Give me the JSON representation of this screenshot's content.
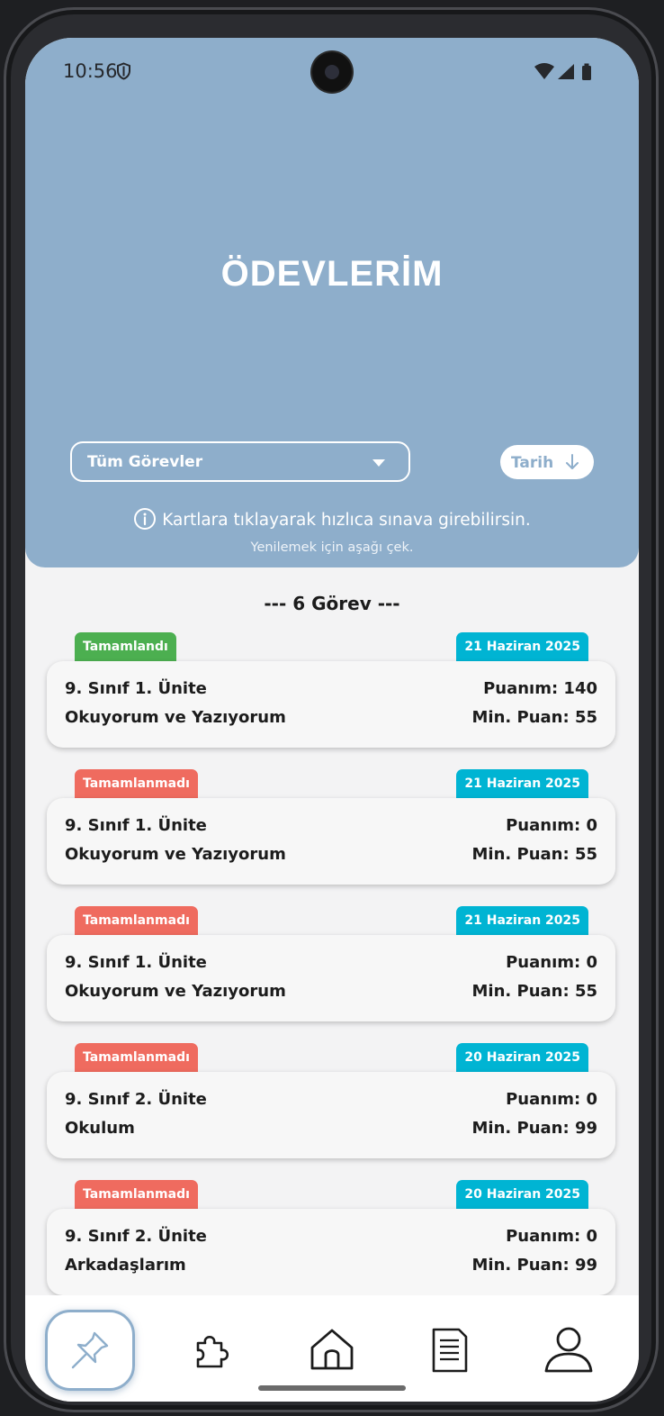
{
  "status_bar": {
    "time": "10:56"
  },
  "header": {
    "title": "ÖDEVLERİM",
    "filter": {
      "selected": "Tüm Görevler"
    },
    "sort": {
      "label": "Tarih"
    },
    "info_text": "Kartlara tıklayarak hızlıca sınava girebilirsin.",
    "refresh_hint": "Yenilemek için aşağı çek."
  },
  "list": {
    "count_text": "--- 6 Görev ---",
    "tasks": [
      {
        "status": "Tamamlandı",
        "status_type": "done",
        "date": "21 Haziran 2025",
        "unit": "9. Sınıf 1. Ünite",
        "topic": "Okuyorum ve Yazıyorum",
        "score": "Puanım: 140",
        "min_score": "Min. Puan: 55"
      },
      {
        "status": "Tamamlanmadı",
        "status_type": "notdone",
        "date": "21 Haziran 2025",
        "unit": "9. Sınıf 1. Ünite",
        "topic": "Okuyorum ve Yazıyorum",
        "score": "Puanım: 0",
        "min_score": "Min. Puan: 55"
      },
      {
        "status": "Tamamlanmadı",
        "status_type": "notdone",
        "date": "21 Haziran 2025",
        "unit": "9. Sınıf 1. Ünite",
        "topic": "Okuyorum ve Yazıyorum",
        "score": "Puanım: 0",
        "min_score": "Min. Puan: 55"
      },
      {
        "status": "Tamamlanmadı",
        "status_type": "notdone",
        "date": "20 Haziran 2025",
        "unit": "9. Sınıf 2. Ünite",
        "topic": "Okulum",
        "score": "Puanım: 0",
        "min_score": "Min. Puan: 99"
      },
      {
        "status": "Tamamlanmadı",
        "status_type": "notdone",
        "date": "20 Haziran 2025",
        "unit": "9. Sınıf 2. Ünite",
        "topic": "Arkadaşlarım",
        "score": "Puanım: 0",
        "min_score": "Min. Puan: 99"
      }
    ]
  },
  "bottom_nav": {
    "items": [
      {
        "icon": "pin-icon",
        "active": true
      },
      {
        "icon": "puzzle-icon",
        "active": false
      },
      {
        "icon": "home-icon",
        "active": false
      },
      {
        "icon": "document-icon",
        "active": false
      },
      {
        "icon": "user-icon",
        "active": false
      }
    ]
  },
  "colors": {
    "header": "#8eaecb",
    "done": "#4caf50",
    "not_done": "#ef6b5f",
    "date_tag": "#00b4d3"
  }
}
